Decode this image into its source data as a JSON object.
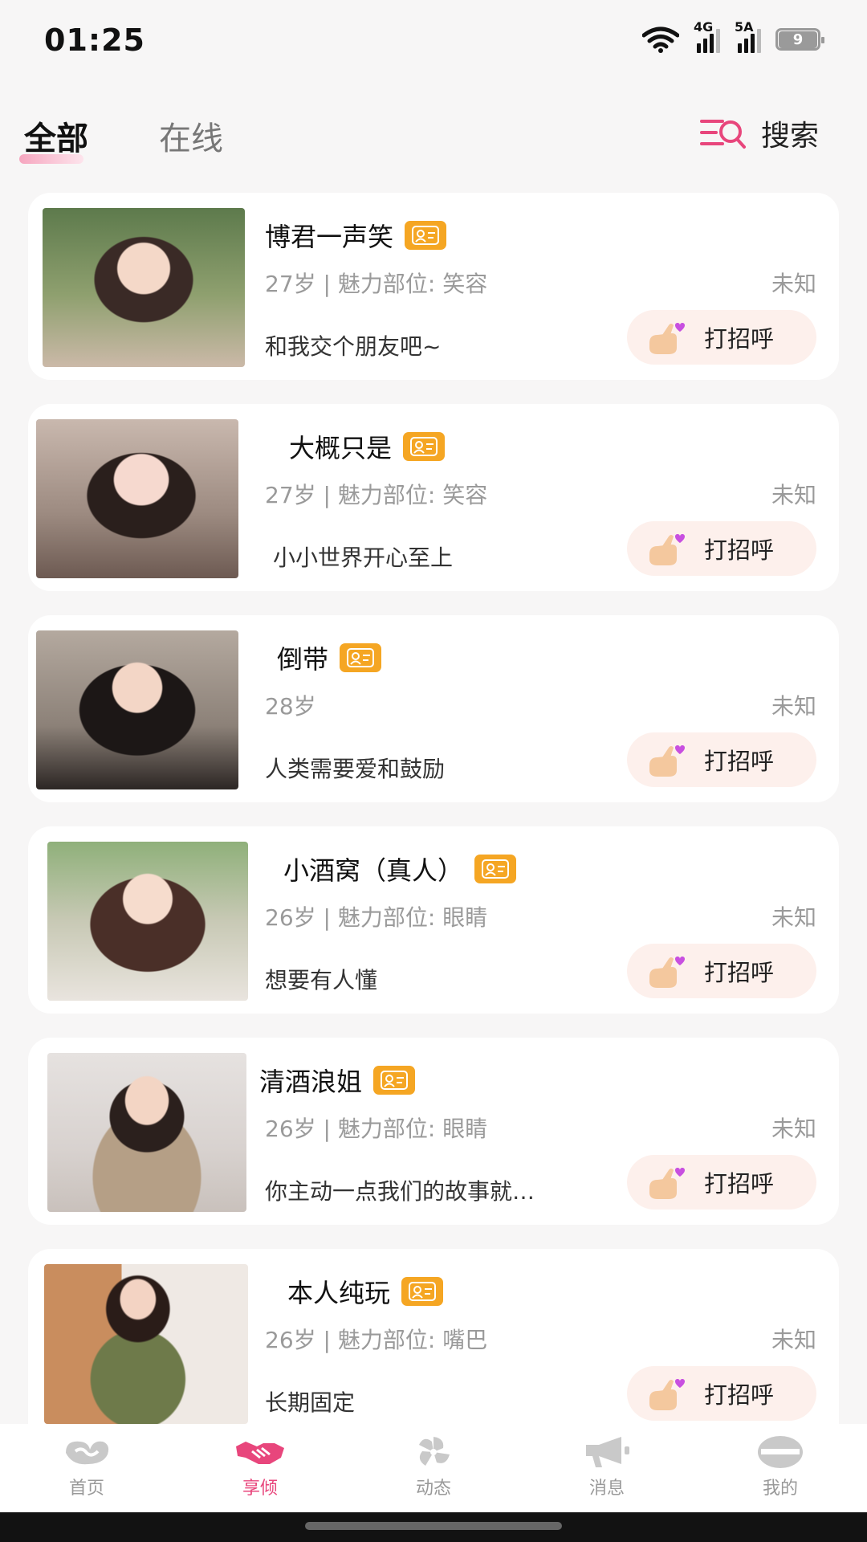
{
  "status": {
    "time": "01:25",
    "net1": "4G",
    "net2": "5A",
    "battery": "9"
  },
  "tabs": {
    "all": "全部",
    "online": "在线"
  },
  "search": {
    "label": "搜索"
  },
  "cards": [
    {
      "name": "博君一声笑",
      "meta": "27岁 | 魅力部位:  笑容",
      "distance": "未知",
      "bio": "和我交个朋友吧~",
      "greet": "打招呼"
    },
    {
      "name": "大概只是",
      "meta": "27岁 | 魅力部位:  笑容",
      "distance": "未知",
      "bio": "小小世界开心至上",
      "greet": "打招呼"
    },
    {
      "name": "倒带",
      "meta": "28岁",
      "distance": "未知",
      "bio": "人类需要爱和鼓励",
      "greet": "打招呼"
    },
    {
      "name": "小酒窝（真人）",
      "meta": "26岁 | 魅力部位:  眼睛",
      "distance": "未知",
      "bio": "想要有人懂",
      "greet": "打招呼"
    },
    {
      "name": "清酒浪姐",
      "meta": "26岁 | 魅力部位:  眼睛",
      "distance": "未知",
      "bio": "你主动一点我们的故事就…",
      "greet": "打招呼"
    },
    {
      "name": "本人纯玩",
      "meta": "26岁 | 魅力部位:  嘴巴",
      "distance": "未知",
      "bio": "长期固定",
      "greet": "打招呼"
    }
  ],
  "nav": [
    {
      "label": "首页",
      "icon": "home-logo-icon"
    },
    {
      "label": "享倾",
      "icon": "handshake-icon"
    },
    {
      "label": "动态",
      "icon": "pinwheel-icon"
    },
    {
      "label": "消息",
      "icon": "megaphone-icon"
    },
    {
      "label": "我的",
      "icon": "profile-icon"
    }
  ],
  "colors": {
    "accent": "#e8467c",
    "badge": "#f5a623",
    "greet_bg": "#fdf0ec",
    "page_bg": "#f7f6f6"
  }
}
